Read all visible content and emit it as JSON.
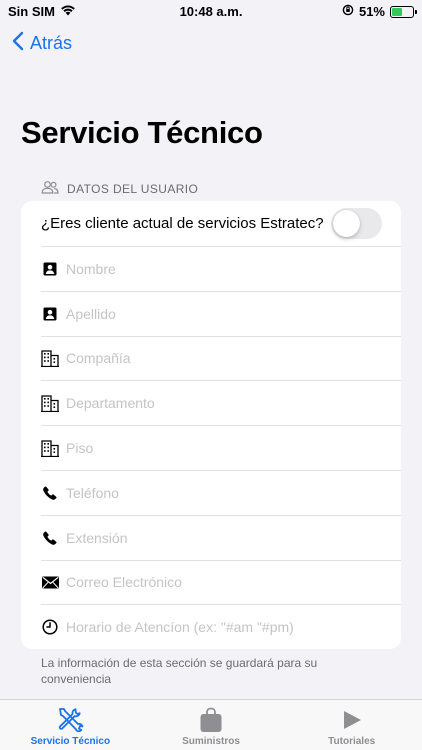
{
  "status_bar": {
    "carrier": "Sin SIM",
    "time": "10:48 a.m.",
    "battery_percent": "51%",
    "battery_level": 0.51
  },
  "nav": {
    "back_label": "Atrás"
  },
  "page": {
    "title": "Servicio Técnico"
  },
  "section": {
    "header": "DATOS DEL USUARIO",
    "toggle_label": "¿Eres cliente actual de servicios Estratec?",
    "toggle_on": false,
    "fields": [
      {
        "icon": "person-card-icon",
        "placeholder": "Nombre",
        "value": ""
      },
      {
        "icon": "person-card-icon",
        "placeholder": "Apellido",
        "value": ""
      },
      {
        "icon": "building-icon",
        "placeholder": "Compañía",
        "value": ""
      },
      {
        "icon": "building-icon",
        "placeholder": "Departamento",
        "value": ""
      },
      {
        "icon": "building-icon",
        "placeholder": "Piso",
        "value": ""
      },
      {
        "icon": "phone-icon",
        "placeholder": "Teléfono",
        "value": ""
      },
      {
        "icon": "phone-icon",
        "placeholder": "Extensión",
        "value": ""
      },
      {
        "icon": "envelope-icon",
        "placeholder": "Correo Electrónico",
        "value": ""
      },
      {
        "icon": "clock-icon",
        "placeholder": "Horario de Atencíon (ex: \"#am \"#pm)",
        "value": ""
      }
    ],
    "footer": "La información de esta sección se guardará para su conveniencia"
  },
  "tab_bar": {
    "tabs": [
      {
        "label": "Servicio Técnico",
        "icon": "tools-icon",
        "active": true
      },
      {
        "label": "Suministros",
        "icon": "bag-icon",
        "active": false
      },
      {
        "label": "Tutoriales",
        "icon": "play-icon",
        "active": false
      }
    ]
  },
  "colors": {
    "accent": "#1a73e8",
    "background": "#f2f2f7",
    "battery": "#34c759"
  }
}
